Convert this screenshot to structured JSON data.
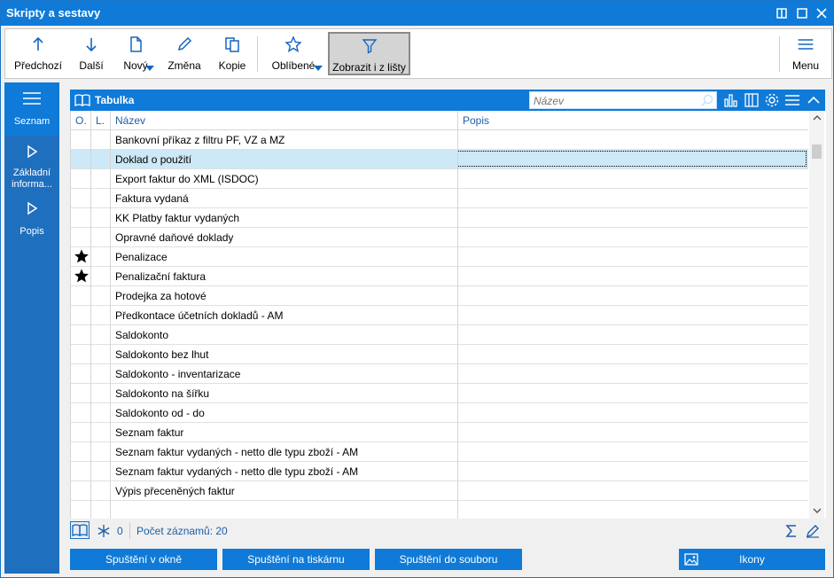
{
  "window": {
    "title": "Skripty a sestavy"
  },
  "toolbar": {
    "prev": "Předchozí",
    "next": "Další",
    "new": "Nový",
    "edit": "Změna",
    "copy": "Kopie",
    "favorites": "Oblíbené",
    "show_from_bar": "Zobrazit i z lišty",
    "menu": "Menu"
  },
  "leftnav": {
    "items": [
      {
        "label": "Seznam"
      },
      {
        "label": "Základní informa..."
      },
      {
        "label": "Popis"
      }
    ]
  },
  "table": {
    "title": "Tabulka",
    "search_placeholder": "Název",
    "columns": [
      "O.",
      "L.",
      "Název",
      "Popis"
    ],
    "rows": [
      {
        "name": "Bankovní příkaz z filtru PF, VZ a MZ",
        "fav": false
      },
      {
        "name": "Doklad o použití",
        "fav": false,
        "selected": true
      },
      {
        "name": "Export faktur do XML (ISDOC)",
        "fav": false
      },
      {
        "name": "Faktura vydaná",
        "fav": false
      },
      {
        "name": "KK Platby faktur vydaných",
        "fav": false
      },
      {
        "name": "Opravné daňové doklady",
        "fav": false
      },
      {
        "name": "Penalizace",
        "fav": true
      },
      {
        "name": "Penalizační faktura",
        "fav": true
      },
      {
        "name": "Prodejka za hotové",
        "fav": false
      },
      {
        "name": "Předkontace účetních dokladů - AM",
        "fav": false
      },
      {
        "name": "Saldokonto",
        "fav": false
      },
      {
        "name": "Saldokonto  bez lhut",
        "fav": false
      },
      {
        "name": "Saldokonto - inventarizace",
        "fav": false
      },
      {
        "name": "Saldokonto na šířku",
        "fav": false
      },
      {
        "name": "Saldokonto od - do",
        "fav": false
      },
      {
        "name": "Seznam faktur",
        "fav": false
      },
      {
        "name": "Seznam faktur vydaných - netto dle typu zboží - AM",
        "fav": false
      },
      {
        "name": "Seznam faktur vydaných - netto dle typu zboží - AM",
        "fav": false
      },
      {
        "name": "Výpis přeceněných faktur",
        "fav": false
      }
    ]
  },
  "status": {
    "filter_count": "0",
    "record_count": "Počet záznamů: 20"
  },
  "actions": {
    "run_window": "Spuštění v okně",
    "run_printer": "Spuštění na tiskárnu",
    "run_file": "Spuštění do souboru",
    "icons": "Ikony"
  },
  "colors": {
    "accent": "#0f7ad8",
    "nav": "#1f6fbf",
    "selection": "#cde8f7",
    "header_text": "#1f5fa8"
  }
}
